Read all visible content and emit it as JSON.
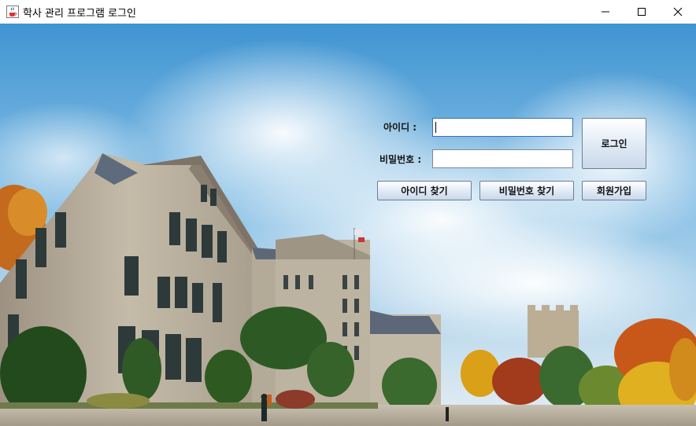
{
  "window": {
    "title": "학사 관리 프로그램 로그인",
    "icon": "java-cup-icon",
    "controls": [
      "minimize-icon",
      "maximize-icon",
      "close-icon"
    ]
  },
  "login": {
    "id_label": "아이디 :",
    "password_label": "비밀번호 :",
    "id_value": "",
    "password_value": "",
    "login_button": "로그인",
    "find_id_button": "아이디 찾기",
    "find_password_button": "비밀번호 찾기",
    "signup_button": "회원가입"
  },
  "background": {
    "description_icon": "campus-photo",
    "sky_color": "#4a9fd8",
    "building_color": "#b8ad9c"
  }
}
